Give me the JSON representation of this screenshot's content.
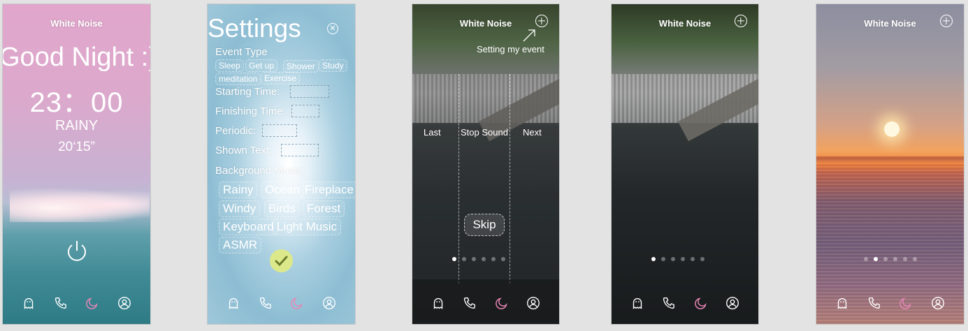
{
  "screens": {
    "home": {
      "title": "White Noise",
      "greeting": "Good Night :)",
      "time": "23：00",
      "weather": "RAINY",
      "duration": "20‘15”",
      "tabs": [
        "ghost-icon",
        "phone-icon",
        "moon-icon",
        "user-icon"
      ]
    },
    "settings": {
      "title": "Settings",
      "close": "⊗",
      "event_type_label": "Event Type",
      "event_types": [
        "Sleep",
        "Get up",
        "Shower",
        "Study",
        "meditation",
        "Exercise"
      ],
      "starting_time_label": "Starting Time:",
      "finishing_time_label": "Finishing Time:",
      "periodic_label": "Periodic:",
      "shown_text_label": "Shown Text:",
      "background_music_label": "Background Music:",
      "music_options": [
        "Rainy",
        "Ocean",
        "Fireplace",
        "Windy",
        "Birds",
        "Forest",
        "Keyboard",
        "Light Music",
        "ASMR"
      ]
    },
    "guide": {
      "title": "White Noise",
      "hint": "Setting my event",
      "last": "Last",
      "stop_sound": "Stop Sound",
      "next": "Next",
      "skip": "Skip",
      "page_indicator": {
        "count": 6,
        "active": 1
      }
    },
    "rain": {
      "title": "White Noise",
      "page_indicator": {
        "count": 6,
        "active": 1
      }
    },
    "sunset": {
      "title": "White Noise",
      "page_indicator": {
        "count": 6,
        "active": 2
      }
    }
  },
  "colors": {
    "accent_tab": "#e887b7",
    "check_button": "#dce98b"
  }
}
